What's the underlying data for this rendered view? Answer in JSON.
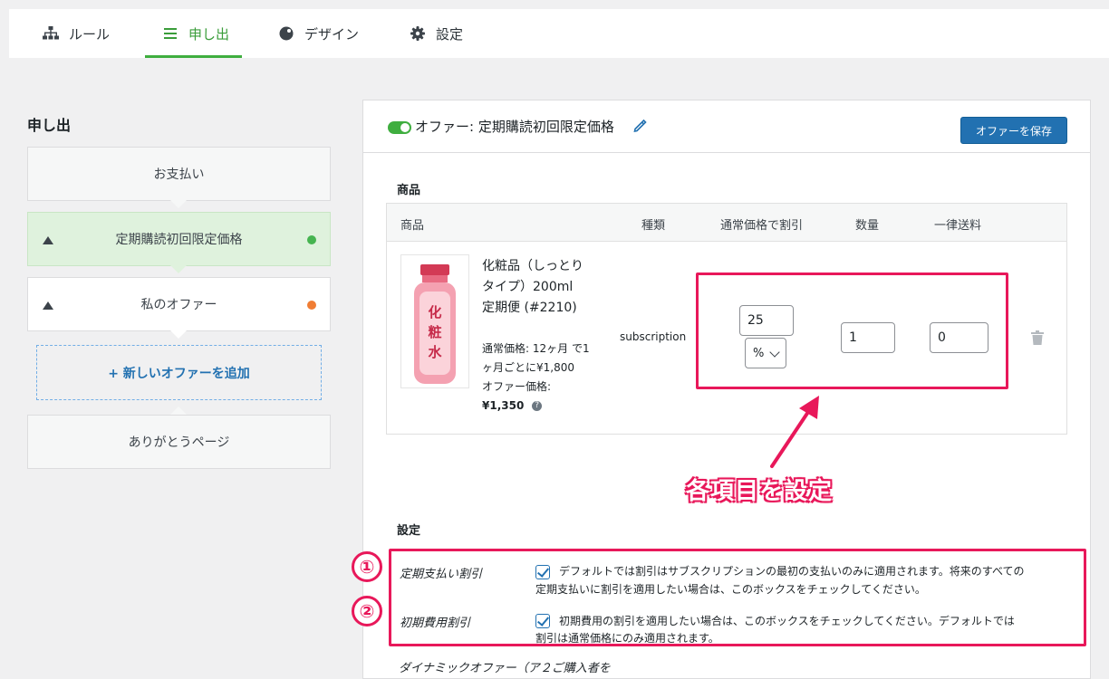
{
  "tabs": [
    {
      "label": "ルール",
      "icon": "sitemap-icon"
    },
    {
      "label": "申し出",
      "icon": "list-icon",
      "active": true
    },
    {
      "label": "デザイン",
      "icon": "palette-icon"
    },
    {
      "label": "設定",
      "icon": "gear-icon"
    }
  ],
  "left": {
    "title": "申し出",
    "steps": {
      "payment": "お支払い",
      "offer1": "定期購読初回限定価格",
      "offer2": "私のオファー",
      "add": "+ 新しいオファーを追加",
      "thanks": "ありがとうページ"
    },
    "colors": {
      "active_dot": "#46b450",
      "inactive_dot": "#f07d34"
    }
  },
  "panel": {
    "offer_title": "オファー: 定期購読初回限定価格",
    "save_label": "オファーを保存",
    "products_section": "商品",
    "columns": {
      "product": "商品",
      "type": "種類",
      "discount": "通常価格で割引",
      "qty": "数量",
      "shipping": "一律送料"
    },
    "product": {
      "name": "化粧品（しっとりタイプ）200ml　定期便 (#2210)",
      "price_line1": "通常価格: 12ヶ月 で1ヶ月ごとに¥1,800",
      "price_line2_label": "オファー価格:",
      "price_line2_value": "¥1,350",
      "type": "subscription",
      "discount_value": "25",
      "discount_unit": "%",
      "qty_value": "1",
      "shipping_value": "0",
      "label_text": "化粧水"
    },
    "callout": "各項目を設定",
    "settings_section": "設定",
    "settings": [
      {
        "num": "①",
        "label": "定期支払い割引",
        "desc1": "デフォルトでは割引はサブスクリプションの最初の支払いのみに適用されます。将来のすべての",
        "desc2": "定期支払いに割引を適用したい場合は、このボックスをチェックしてください。"
      },
      {
        "num": "②",
        "label": "初期費用割引",
        "desc1": "初期費用の割引を適用したい場合は、このボックスをチェックしてください。デフォルトでは",
        "desc2": "割引は通常価格にのみ適用されます。"
      }
    ],
    "cut_row": "ダイナミックオファー（ア２ご購入者を"
  },
  "colors": {
    "accent_green": "#3fae3f",
    "primary_blue": "#2271b1",
    "highlight_pink": "#e8185a"
  }
}
